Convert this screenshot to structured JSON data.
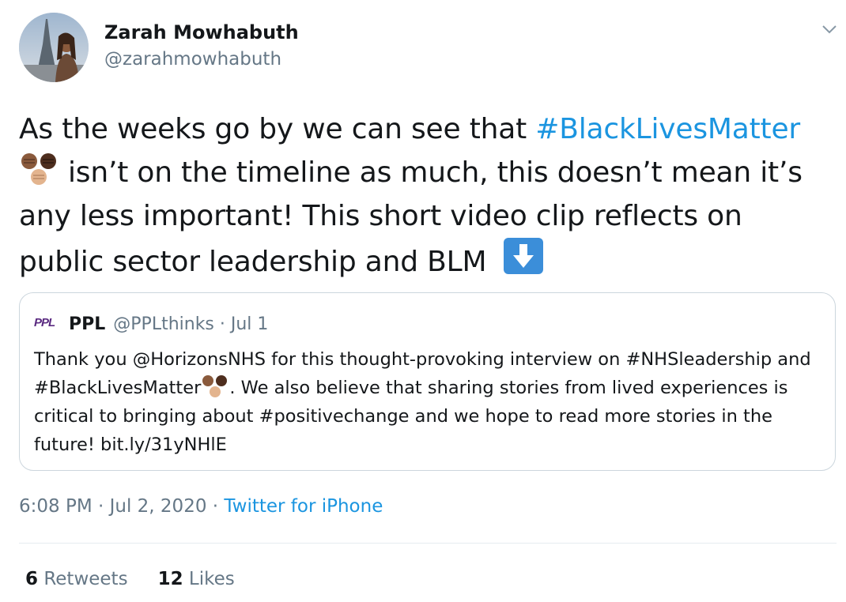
{
  "author": {
    "display_name": "Zarah Mowhabuth",
    "handle": "@zarahmowhabuth"
  },
  "tweet": {
    "text_1": "As the weeks go by we can see that ",
    "hashtag": "#BlackLivesMatter",
    "text_2": "isn’t on the timeline as much, this doesn’t mean it’s any less important! This short video clip reflects on public sector leadership and BLM",
    "emoji_fists": "raised-fists-emoji",
    "emoji_arrow": "down-arrow-emoji"
  },
  "quoted": {
    "logo_text": "PPL",
    "name": "PPL",
    "handle_date": "@PPLthinks · Jul 1",
    "body_1": "Thank you @HorizonsNHS for this thought-provoking interview on #NHSleadership and #BlackLivesMatter",
    "body_2": ". We also believe that sharing stories from lived experiences is critical to bringing about #positivechange and we hope to read more stories in the future! bit.ly/31yNHlE"
  },
  "meta": {
    "time_date": "6:08 PM · Jul 2, 2020 · ",
    "source": "Twitter for iPhone"
  },
  "stats": {
    "retweets_count": "6",
    "retweets_label": " Retweets",
    "likes_count": "12",
    "likes_label": " Likes"
  },
  "colors": {
    "link": "#1b95e0",
    "secondary_text": "#657786",
    "border": "#ccd6dd"
  }
}
